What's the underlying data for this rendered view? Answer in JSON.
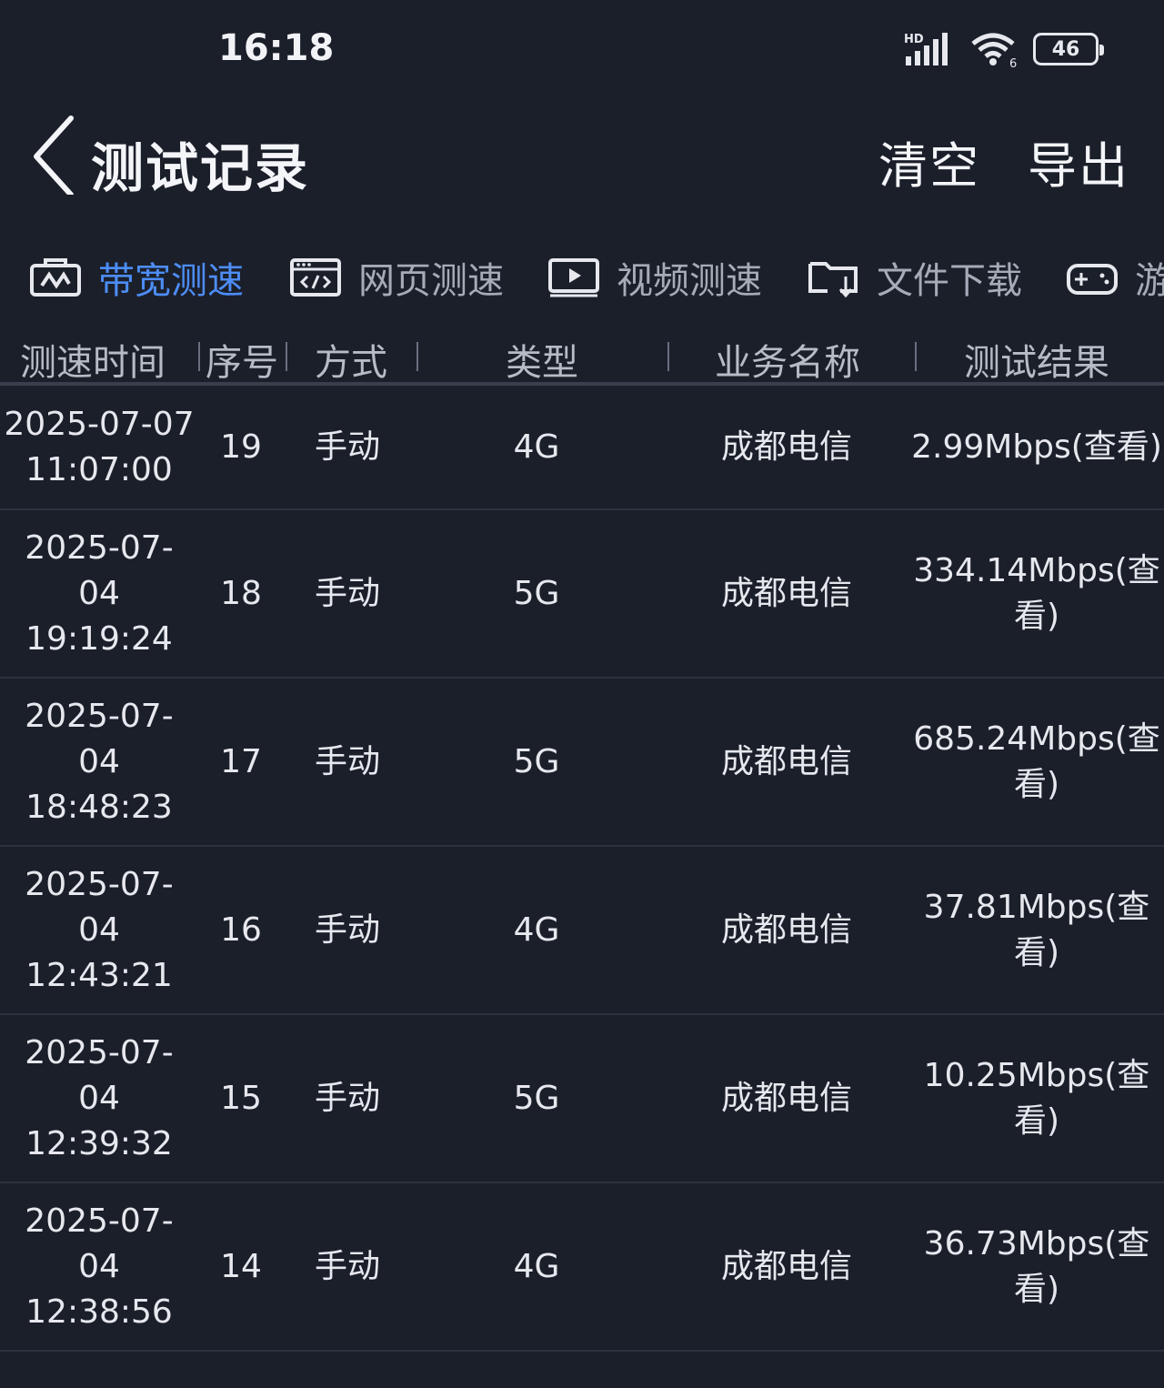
{
  "status_bar": {
    "time": "16:18",
    "signal_icon": "signal-hd-icon",
    "wifi_icon": "wifi-6-icon",
    "battery": "46"
  },
  "nav": {
    "back_icon": "chevron-left-icon",
    "title": "测试记录",
    "clear_label": "清空",
    "export_label": "导出"
  },
  "tabs": [
    {
      "label": "带宽测速",
      "icon": "bandwidth-icon",
      "active": true
    },
    {
      "label": "网页测速",
      "icon": "webpage-code-icon",
      "active": false
    },
    {
      "label": "视频测速",
      "icon": "video-play-icon",
      "active": false
    },
    {
      "label": "文件下载",
      "icon": "folder-download-icon",
      "active": false
    },
    {
      "label": "游",
      "icon": "gamepad-icon",
      "active": false
    }
  ],
  "columns": {
    "time": "测速时间",
    "seq": "序号",
    "mode": "方式",
    "type": "类型",
    "business": "业务名称",
    "result": "测试结果"
  },
  "rows": [
    {
      "time": "2025-07-07 11:07:00",
      "seq": "19",
      "mode": "手动",
      "type": "4G",
      "business": "成都电信",
      "result": "2.99Mbps(查看)"
    },
    {
      "time": "2025-07-04 19:19:24",
      "seq": "18",
      "mode": "手动",
      "type": "5G",
      "business": "成都电信",
      "result": "334.14Mbps(查看)"
    },
    {
      "time": "2025-07-04 18:48:23",
      "seq": "17",
      "mode": "手动",
      "type": "5G",
      "business": "成都电信",
      "result": "685.24Mbps(查看)"
    },
    {
      "time": "2025-07-04 12:43:21",
      "seq": "16",
      "mode": "手动",
      "type": "4G",
      "business": "成都电信",
      "result": "37.81Mbps(查看)"
    },
    {
      "time": "2025-07-04 12:39:32",
      "seq": "15",
      "mode": "手动",
      "type": "5G",
      "business": "成都电信",
      "result": "10.25Mbps(查看)"
    },
    {
      "time": "2025-07-04 12:38:56",
      "seq": "14",
      "mode": "手动",
      "type": "4G",
      "business": "成都电信",
      "result": "36.73Mbps(查看)"
    }
  ]
}
